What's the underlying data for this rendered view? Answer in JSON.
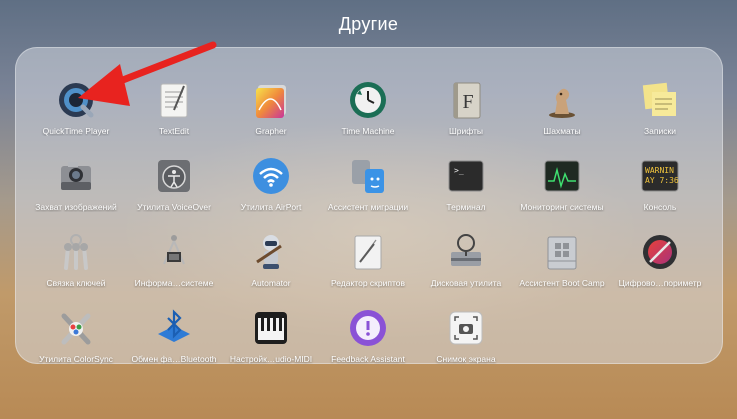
{
  "folder": {
    "title": "Другие"
  },
  "apps": [
    {
      "label": "QuickTime Player",
      "icon": "quicktime-icon"
    },
    {
      "label": "TextEdit",
      "icon": "textedit-icon"
    },
    {
      "label": "Grapher",
      "icon": "grapher-icon"
    },
    {
      "label": "Time Machine",
      "icon": "time-machine-icon"
    },
    {
      "label": "Шрифты",
      "icon": "font-book-icon"
    },
    {
      "label": "Шахматы",
      "icon": "chess-icon"
    },
    {
      "label": "Записки",
      "icon": "stickies-icon"
    },
    {
      "label": "Захват изображений",
      "icon": "image-capture-icon"
    },
    {
      "label": "Утилита VoiceOver",
      "icon": "voiceover-icon"
    },
    {
      "label": "Утилита AirPort",
      "icon": "airport-icon"
    },
    {
      "label": "Ассистент миграции",
      "icon": "migration-assistant-icon"
    },
    {
      "label": "Терминал",
      "icon": "terminal-icon"
    },
    {
      "label": "Мониторинг системы",
      "icon": "activity-monitor-icon"
    },
    {
      "label": "Консоль",
      "icon": "console-icon"
    },
    {
      "label": "Связка ключей",
      "icon": "keychain-icon"
    },
    {
      "label": "Информа…системе",
      "icon": "system-info-icon"
    },
    {
      "label": "Automator",
      "icon": "automator-icon"
    },
    {
      "label": "Редактор скриптов",
      "icon": "script-editor-icon"
    },
    {
      "label": "Дисковая утилита",
      "icon": "disk-utility-icon"
    },
    {
      "label": "Ассистент Boot Camp",
      "icon": "boot-camp-icon"
    },
    {
      "label": "Цифрово…пориметр",
      "icon": "digital-color-meter-icon"
    },
    {
      "label": "Утилита ColorSync",
      "icon": "colorsync-icon"
    },
    {
      "label": "Обмен фа…Bluetooth",
      "icon": "bluetooth-icon"
    },
    {
      "label": "Настройк…udio-MIDI",
      "icon": "audio-midi-icon"
    },
    {
      "label": "Feedback Assistant",
      "icon": "feedback-assistant-icon"
    },
    {
      "label": "Снимок экрана",
      "icon": "screenshot-icon"
    }
  ],
  "console_icon_text": [
    "WARNIN",
    "AY 7:36"
  ],
  "colors": {
    "arrow": "#e8231f",
    "label": "#ffffff"
  }
}
